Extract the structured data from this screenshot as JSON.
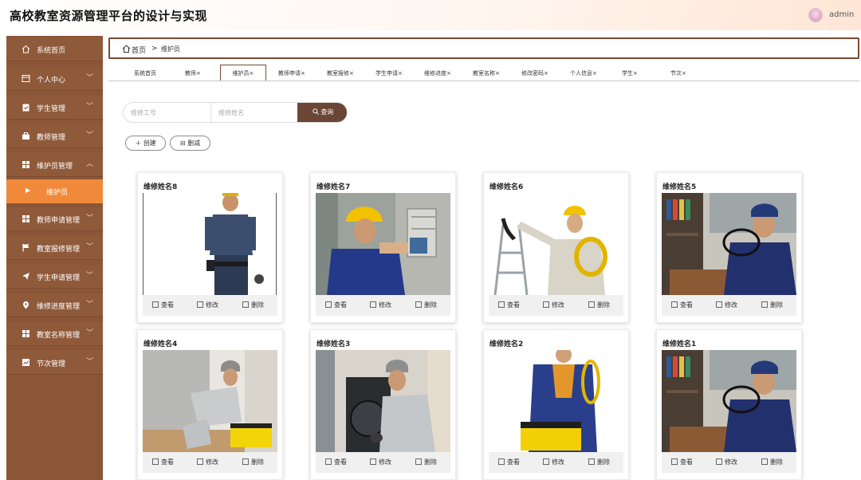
{
  "app": {
    "title": "高校教室资源管理平台的设计与实现",
    "username": "admin"
  },
  "sidebar": {
    "items": [
      {
        "label": "系统首页",
        "icon": "home-icon",
        "chev": false
      },
      {
        "label": "个人中心",
        "icon": "profile-icon",
        "chev": true
      },
      {
        "label": "学生管理",
        "icon": "clipboard-icon",
        "chev": true
      },
      {
        "label": "教师管理",
        "icon": "briefcase-icon",
        "chev": true
      },
      {
        "label": "维护员管理",
        "icon": "grid-icon",
        "chev": true,
        "expanded": true
      },
      {
        "label": "教师申请管理",
        "icon": "grid-icon",
        "chev": true
      },
      {
        "label": "教室报修管理",
        "icon": "flag-icon",
        "chev": true
      },
      {
        "label": "学生申请管理",
        "icon": "send-icon",
        "chev": true
      },
      {
        "label": "维修进度管理",
        "icon": "pin-icon",
        "chev": true
      },
      {
        "label": "教室名称管理",
        "icon": "grid-icon",
        "chev": true
      },
      {
        "label": "节次管理",
        "icon": "chart-icon",
        "chev": true
      }
    ],
    "sub_item": {
      "label": "维护员"
    }
  },
  "breadcrumb": {
    "home": "首页",
    "separator": ">",
    "current": "维护员"
  },
  "tabs": [
    "系统首页",
    "教师×",
    "维护员×",
    "教师申请×",
    "教室报修×",
    "学生申请×",
    "维修进度×",
    "教室名称×",
    "修改密码×",
    "个人信息×",
    "学生×",
    "节次×"
  ],
  "search": {
    "id_placeholder": "维修工号",
    "name_placeholder": "维修姓名",
    "button_label": "查询"
  },
  "actions": {
    "create": "创建",
    "delete": "删减"
  },
  "card_actions": {
    "view": "查看",
    "edit": "修改",
    "delete": "删除"
  },
  "cards": [
    {
      "name": "维修姓名8"
    },
    {
      "name": "维修姓名7"
    },
    {
      "name": "维修姓名6"
    },
    {
      "name": "维修姓名5"
    },
    {
      "name": "维修姓名4"
    },
    {
      "name": "维修姓名3"
    },
    {
      "name": "维修姓名2"
    },
    {
      "name": "维修姓名1"
    }
  ],
  "colors": {
    "sidebar": "#8b5637",
    "sidebar_active": "#f08a3a",
    "accent": "#6b4636"
  }
}
